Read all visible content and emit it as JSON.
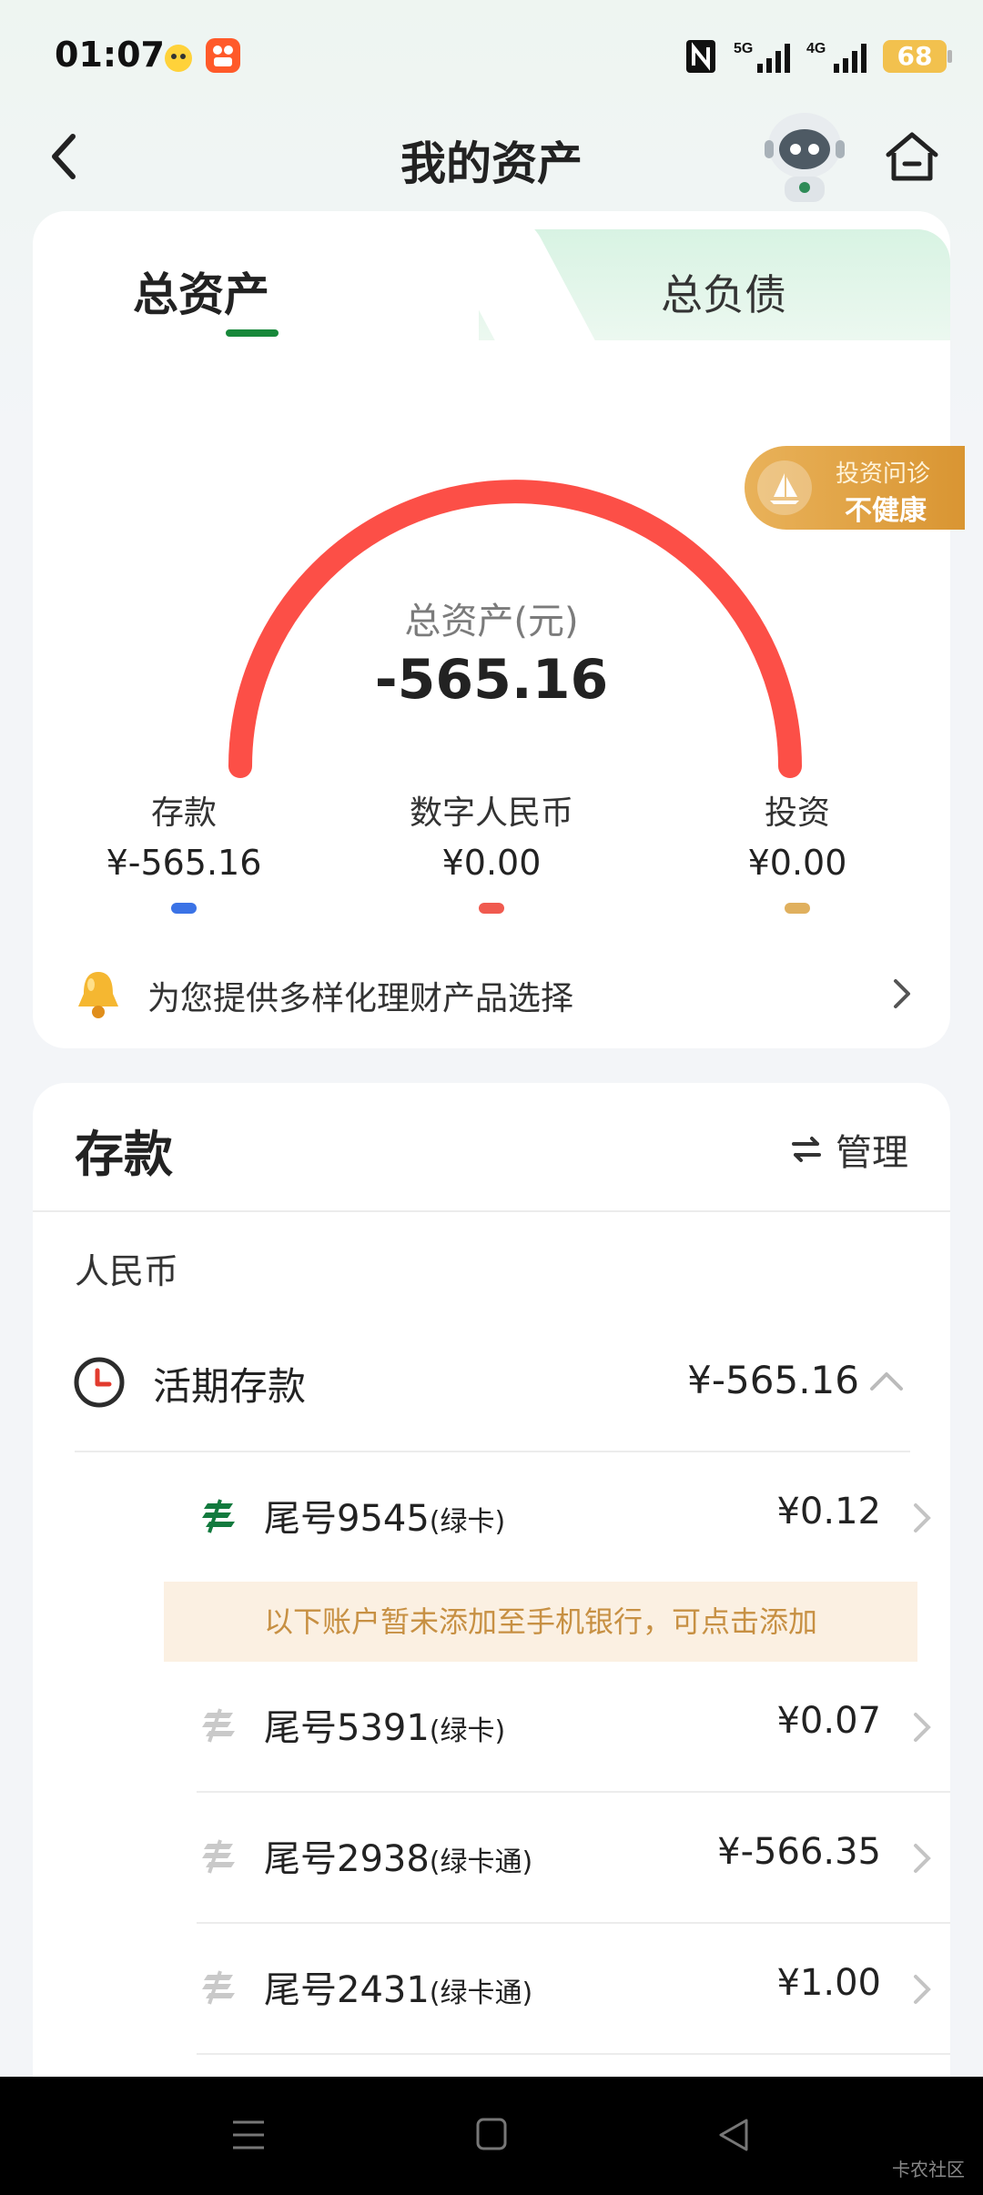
{
  "status_bar": {
    "time": "01:07",
    "battery": "68",
    "network1": "5G",
    "network2": "4G"
  },
  "header": {
    "title": "我的资产"
  },
  "tabs": {
    "assets": "总资产",
    "liabilities": "总负债"
  },
  "badge": {
    "line1": "投资问诊",
    "line2": "不健康"
  },
  "gauge": {
    "label": "总资产(元)",
    "value": "-565.16",
    "fill_fraction": 1.0
  },
  "categories": [
    {
      "label": "存款",
      "value": "¥-565.16",
      "color": "#3b73e6"
    },
    {
      "label": "数字人民币",
      "value": "¥0.00",
      "color": "#f05a4f"
    },
    {
      "label": "投资",
      "value": "¥0.00",
      "color": "#e0b05e"
    }
  ],
  "promo": {
    "text": "为您提供多样化理财产品选择"
  },
  "deposits": {
    "title": "存款",
    "manage": "管理",
    "currency": "人民币",
    "current": {
      "label": "活期存款",
      "value": "¥-565.16"
    },
    "notice": "以下账户暂未添加至手机银行，可点击添加",
    "accounts": [
      {
        "number": "尾号9545",
        "type": "(绿卡)",
        "value": "¥0.12"
      },
      {
        "number": "尾号5391",
        "type": "(绿卡)",
        "value": "¥0.07"
      },
      {
        "number": "尾号2938",
        "type": "(绿卡通)",
        "value": "¥-566.35"
      },
      {
        "number": "尾号2431",
        "type": "(绿卡通)",
        "value": "¥1.00"
      }
    ]
  },
  "colors": {
    "accent_green": "#17883a",
    "gauge_red": "#fc4f47",
    "notice_bg": "#fbf0e2",
    "notice_text": "#c79043"
  },
  "watermark": "卡农社区"
}
